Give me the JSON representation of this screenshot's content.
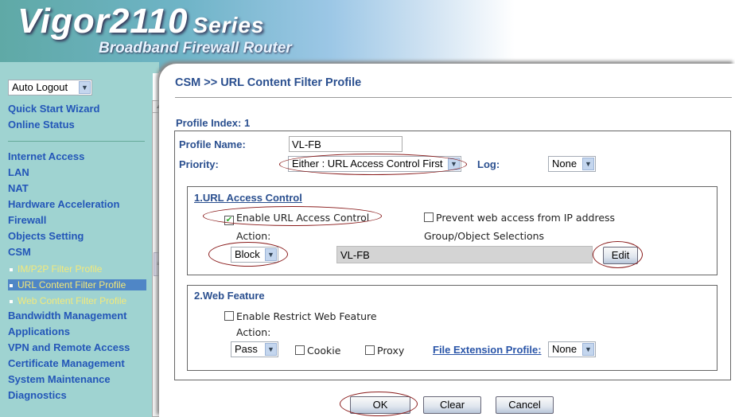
{
  "header": {
    "logo_main": "Vigor2110",
    "logo_series": "Series",
    "logo_sub": "Broadband Firewall Router"
  },
  "sidebar": {
    "auto_logout": "Auto Logout",
    "top_items": [
      "Quick Start Wizard",
      "Online Status"
    ],
    "items": [
      "Internet Access",
      "LAN",
      "NAT",
      "Hardware Acceleration",
      "Firewall",
      "Objects Setting",
      "CSM"
    ],
    "sub_items": [
      "IM/P2P Filter Profile",
      "URL Content Filter Profile",
      "Web Content Filter Profile"
    ],
    "active_sub": "URL Content Filter Profile",
    "bottom_items": [
      "Bandwidth Management",
      "Applications",
      "VPN and Remote Access",
      "Certificate Management",
      "System Maintenance",
      "Diagnostics"
    ]
  },
  "page": {
    "title": "CSM >> URL Content Filter Profile",
    "profile_index": "Profile Index: 1"
  },
  "form": {
    "profile_name_label": "Profile Name:",
    "profile_name": "VL-FB",
    "priority_label": "Priority:",
    "priority": "Either : URL Access Control First",
    "log_label": "Log:",
    "log": "None",
    "url": {
      "title": "1.URL Access Control",
      "enable_label": "Enable URL Access Control",
      "enable_checked": true,
      "prevent_label": "Prevent web access from IP address",
      "prevent_checked": false,
      "action_label": "Action:",
      "action": "Block",
      "group_label": "Group/Object Selections",
      "group_value": "VL-FB",
      "edit": "Edit"
    },
    "web": {
      "title": "2.Web Feature",
      "enable_label": "Enable Restrict Web Feature",
      "enable_checked": false,
      "action_label": "Action:",
      "action": "Pass",
      "cookie_label": "Cookie",
      "proxy_label": "Proxy",
      "file_ext_label": "File Extension Profile:",
      "file_ext": "None"
    }
  },
  "buttons": {
    "ok": "OK",
    "clear": "Clear",
    "cancel": "Cancel"
  },
  "colors": {
    "nav": "#2356b8",
    "sub": "#f3e97a",
    "label": "#2a4f8f",
    "sidebar_bg": "#9fd3d1",
    "annotation": "#8a1c1c"
  }
}
